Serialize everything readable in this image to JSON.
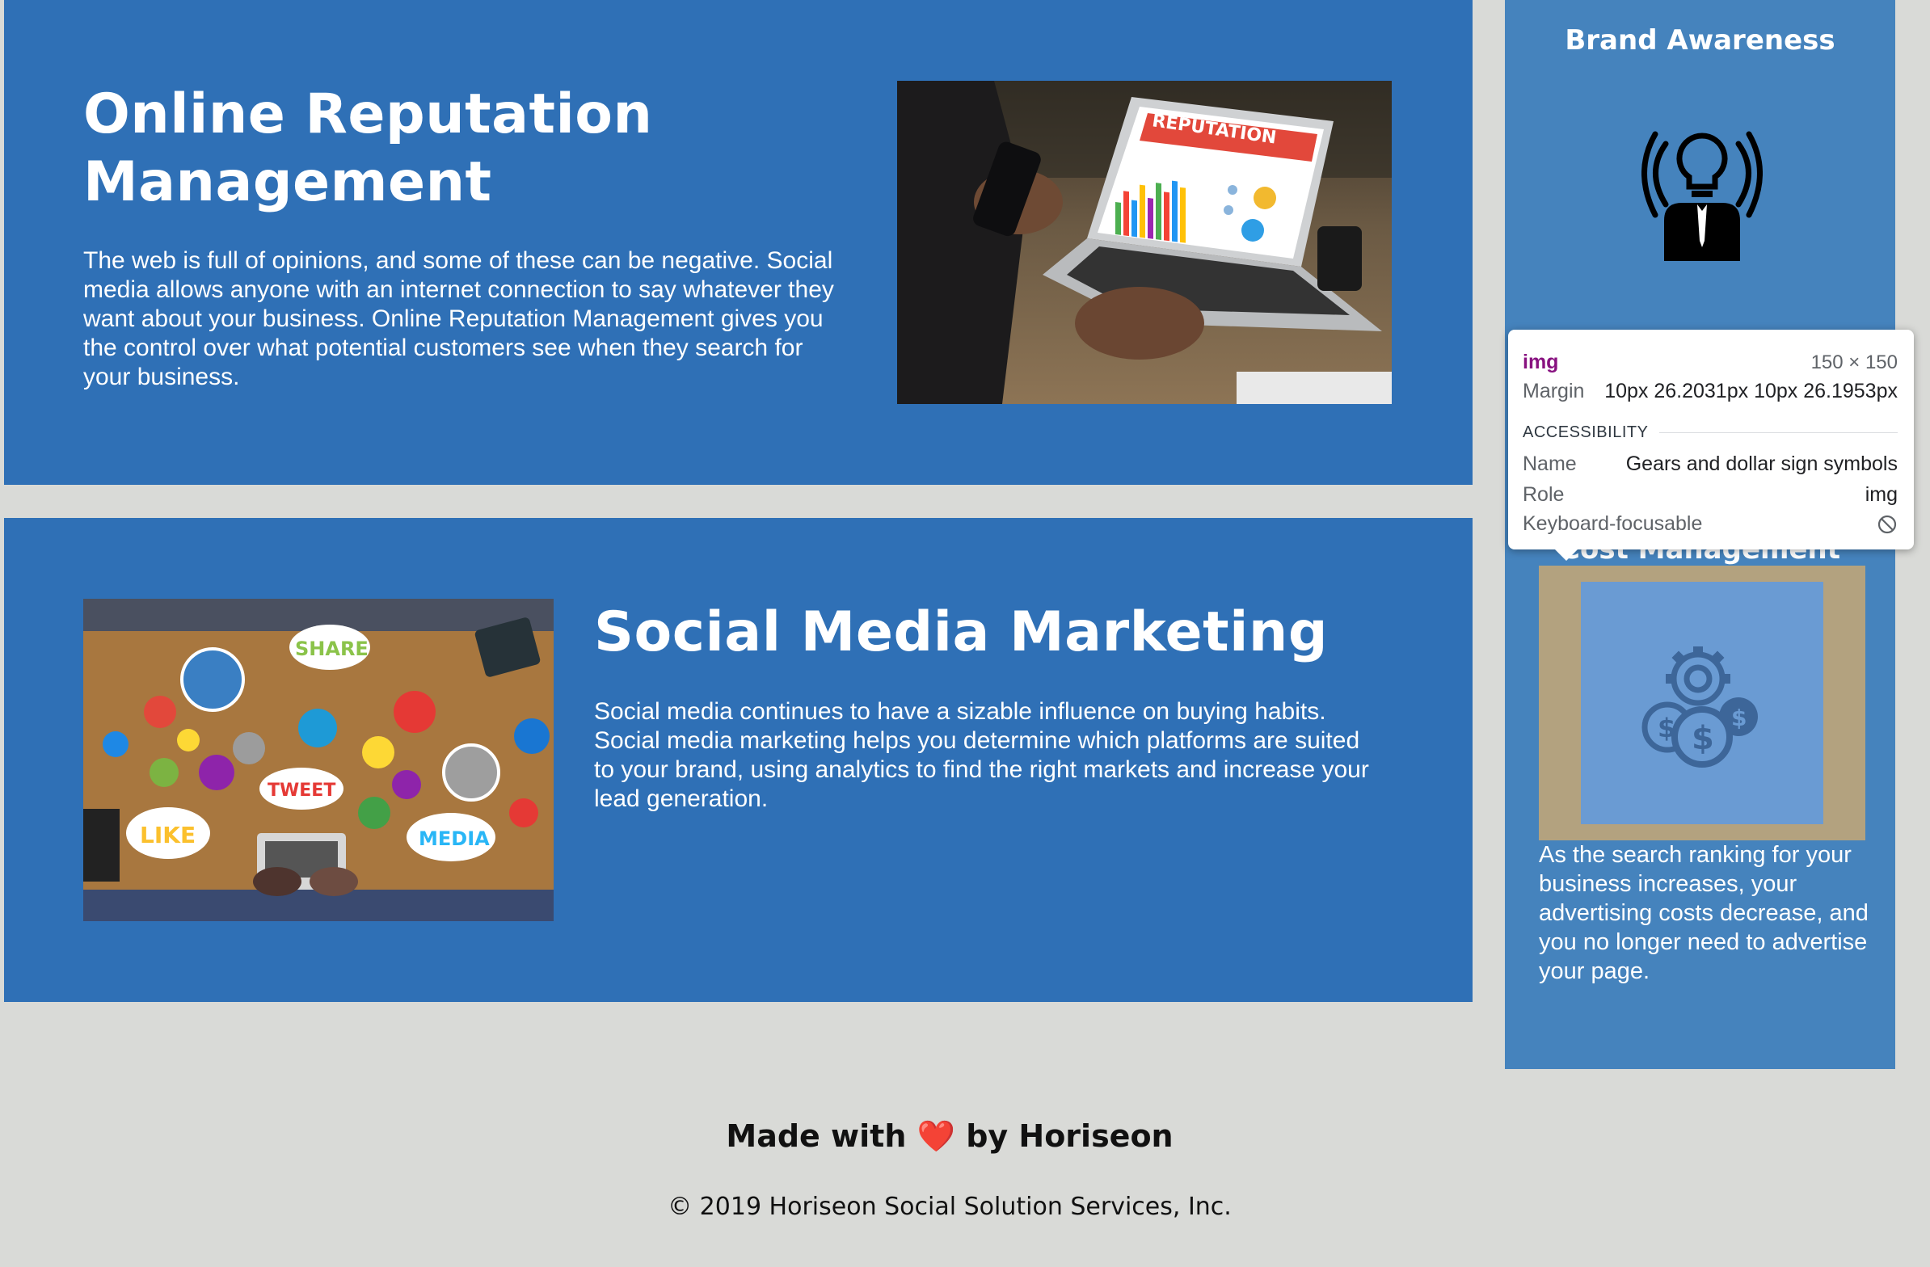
{
  "colors": {
    "page_background": "#d9dad7",
    "card_background": "#2f70b6",
    "sidebar_background": "#4583bd",
    "cost_image_frame": "#b3a27f",
    "cost_image_highlight": "#6a9bd3",
    "heart": "#e0182d"
  },
  "sections": {
    "orm": {
      "title": "Online Reputation Management",
      "text": "The web is full of opinions, and some of these can be negative. Social media allows anyone with an internet connection to say whatever they want about your business. Online Reputation Management gives you the control over what potential customers see when they search for your business.",
      "image_label": "REPUTATION"
    },
    "smm": {
      "title": "Social Media Marketing",
      "text": "Social media continues to have a sizable influence on buying habits. Social media marketing helps you determine which platforms are suited to your brand, using analytics to find the right markets and increase your lead generation.",
      "image_words": [
        "SHARE",
        "TWEET",
        "LIKE",
        "MEDIA"
      ]
    }
  },
  "sidebar": {
    "brand_heading": "Brand Awareness",
    "cost_heading": "Cost Management",
    "cost_text": "As the search ranking for your business increases, your advertising costs decrease, and you no longer need to advertise your page."
  },
  "devtools_tooltip": {
    "tag": "img",
    "size": "150 × 150",
    "margin_label": "Margin",
    "margin_value": "10px 26.2031px 10px 26.1953px",
    "section": "ACCESSIBILITY",
    "name_label": "Name",
    "name_value": "Gears and dollar sign symbols",
    "role_label": "Role",
    "role_value": "img",
    "focusable_label": "Keyboard-focusable",
    "focusable_icon": "not-allowed-icon"
  },
  "footer": {
    "made_prefix": "Made with",
    "heart": "❤️",
    "made_suffix": "by Horiseon",
    "copyright": "© 2019 Horiseon Social Solution Services, Inc."
  }
}
